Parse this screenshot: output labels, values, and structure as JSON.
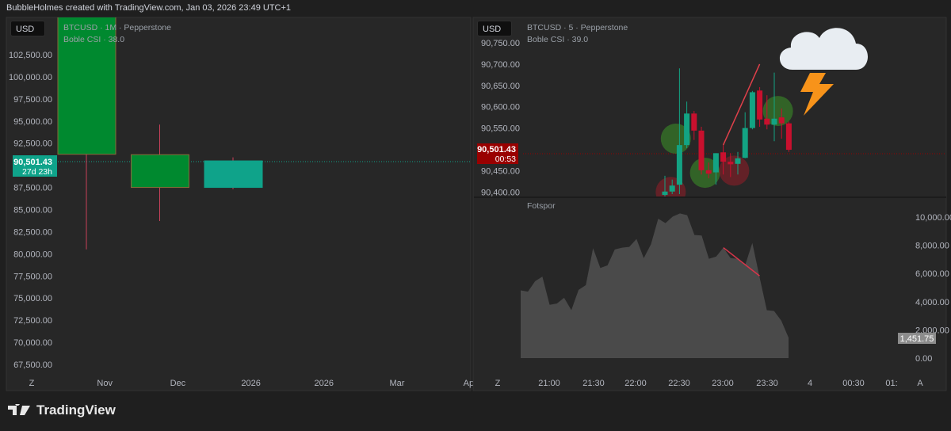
{
  "header": {
    "caption": "BubbleHolmes created with TradingView.com, Jan 03, 2026 23:49 UTC+1"
  },
  "brand": {
    "name": "TradingView"
  },
  "colors": {
    "up_green": "#00892f",
    "teal": "#0fa38a",
    "red": "#c8102e",
    "dark_red": "#990000",
    "area": "#4a4a4a",
    "panel": "#272727",
    "page": "#1f1f1f"
  },
  "left_chart": {
    "currency": "USD",
    "legend_symbol": "BTCUSD · 1M · Pepperstone",
    "legend_indicator": "Boble CSI · 38.0",
    "price_ticks": [
      "102,500.00",
      "100,000.00",
      "97,500.00",
      "95,000.00",
      "92,500.00",
      "87,500.00",
      "85,000.00",
      "82,500.00",
      "80,000.00",
      "77,500.00",
      "75,000.00",
      "72,500.00",
      "70,000.00",
      "67,500.00"
    ],
    "price_tick_values": [
      102500,
      100000,
      97500,
      95000,
      92500,
      87500,
      85000,
      82500,
      80000,
      77500,
      75000,
      72500,
      70000,
      67500
    ],
    "last_price": "90,501.43",
    "countdown": "27d 23h",
    "time_labels": [
      "Z",
      "Nov",
      "Dec",
      "2026",
      "2026",
      "Mar",
      "Apr"
    ],
    "candles": [
      {
        "month": "Nov",
        "open": 91250,
        "high": 110000,
        "low": 80500,
        "close": 110000,
        "color": "#00892f"
      },
      {
        "month": "Dec",
        "open": 91200,
        "high": 94600,
        "low": 83700,
        "close": 87500,
        "color": "#00892f"
      },
      {
        "month": "Jan",
        "open": 87500,
        "high": 90900,
        "low": 87300,
        "close": 90501.43,
        "color": "#0fa38a"
      }
    ]
  },
  "right_chart": {
    "currency": "USD",
    "legend_symbol": "BTCUSD · 5 · Pepperstone",
    "legend_indicator": "Boble CSI · 39.0",
    "price_ticks": [
      "90,750.00",
      "90,700.00",
      "90,650.00",
      "90,600.00",
      "90,550.00",
      "90,450.00",
      "90,400.00"
    ],
    "price_tick_values": [
      90750,
      90700,
      90650,
      90600,
      90550,
      90450,
      90400
    ],
    "last_price": "90,501.43",
    "countdown": "00:53",
    "candles": [
      {
        "o": 90393,
        "h": 90438,
        "l": 90380,
        "c": 90401
      },
      {
        "o": 90401,
        "h": 90429,
        "l": 90395,
        "c": 90415
      },
      {
        "o": 90417,
        "h": 90690,
        "l": 90395,
        "c": 90510
      },
      {
        "o": 90510,
        "h": 90612,
        "l": 90503,
        "c": 90584
      },
      {
        "o": 90584,
        "h": 90590,
        "l": 90522,
        "c": 90544
      },
      {
        "o": 90544,
        "h": 90553,
        "l": 90441,
        "c": 90451
      },
      {
        "o": 90451,
        "h": 90469,
        "l": 90432,
        "c": 90443
      },
      {
        "o": 90446,
        "h": 90491,
        "l": 90417,
        "c": 90491
      },
      {
        "o": 90493,
        "h": 90510,
        "l": 90441,
        "c": 90471
      },
      {
        "o": 90471,
        "h": 90491,
        "l": 90435,
        "c": 90465
      },
      {
        "o": 90466,
        "h": 90494,
        "l": 90441,
        "c": 90479
      },
      {
        "o": 90480,
        "h": 90587,
        "l": 90479,
        "c": 90550
      },
      {
        "o": 90550,
        "h": 90637,
        "l": 90547,
        "c": 90634
      },
      {
        "o": 90638,
        "h": 90646,
        "l": 90553,
        "c": 90570
      },
      {
        "o": 90572,
        "h": 90627,
        "l": 90547,
        "c": 90558
      },
      {
        "o": 90558,
        "h": 90680,
        "l": 90519,
        "c": 90572
      },
      {
        "o": 90575,
        "h": 90596,
        "l": 90525,
        "c": 90561
      },
      {
        "o": 90561,
        "h": 90565,
        "l": 90494,
        "c": 90499
      }
    ],
    "bubbles": [
      {
        "index": 0.8,
        "price": 90400,
        "color": "red"
      },
      {
        "index": 1.5,
        "price": 90525,
        "color": "green"
      },
      {
        "index": 5.5,
        "price": 90445,
        "color": "green"
      },
      {
        "index": 9.5,
        "price": 90450,
        "color": "red"
      },
      {
        "index": 15.5,
        "price": 90590,
        "color": "green"
      }
    ],
    "trendline": [
      {
        "index": 8,
        "price": 90510
      },
      {
        "index": 13,
        "price": 90700
      }
    ],
    "volume_pane": {
      "title": "Fotspor",
      "ticks": [
        "10,000.00",
        "8,000.00",
        "6,000.00",
        "4,000.00",
        "2,000.00",
        "0.00"
      ],
      "tick_values": [
        10000,
        8000,
        6000,
        4000,
        2000,
        0
      ],
      "last_value": "1,451.75",
      "values": [
        4804,
        4710,
        5458,
        5776,
        3776,
        3869,
        4280,
        3402,
        4841,
        5178,
        7794,
        6392,
        6579,
        7701,
        7832,
        7888,
        8449,
        7084,
        8075,
        9888,
        9570,
        10037,
        10262,
        10131,
        8729,
        8692,
        7047,
        7196,
        7832,
        7084,
        7047,
        6579,
        8168,
        5738,
        3402,
        3346,
        2654,
        1452
      ],
      "trendline": [
        {
          "index": 28,
          "value": 7832
        },
        {
          "index": 33,
          "value": 5830
        }
      ]
    },
    "time_labels": [
      "Z",
      "21:00",
      "21:30",
      "22:00",
      "22:30",
      "23:00",
      "23:30",
      "4",
      "00:30",
      "01:",
      "A"
    ]
  }
}
